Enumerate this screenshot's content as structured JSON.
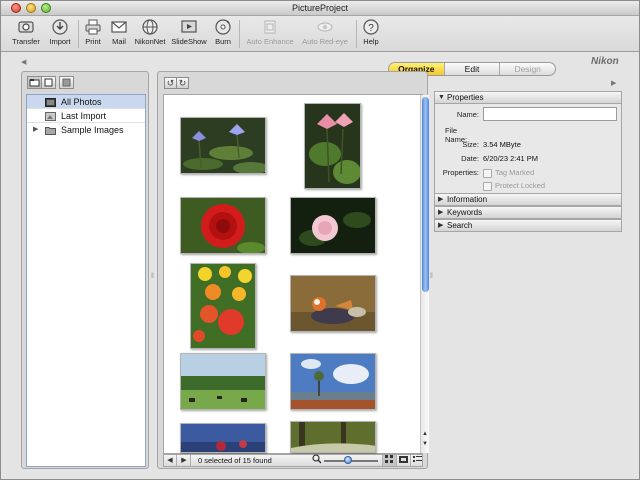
{
  "window": {
    "title": "PictureProject"
  },
  "toolbar": {
    "items": [
      {
        "label": "Transfer",
        "icon": "transfer-icon",
        "enabled": true
      },
      {
        "label": "Import",
        "icon": "import-icon",
        "enabled": true
      },
      {
        "label": "Print",
        "icon": "printer-icon",
        "enabled": true
      },
      {
        "label": "Mail",
        "icon": "mail-icon",
        "enabled": true
      },
      {
        "label": "NikonNet",
        "icon": "globe-icon",
        "enabled": true
      },
      {
        "label": "SlideShow",
        "icon": "slideshow-icon",
        "enabled": true
      },
      {
        "label": "Burn",
        "icon": "burn-disc-icon",
        "enabled": true
      },
      {
        "label": "Auto Enhance",
        "icon": "auto-enhance-icon",
        "enabled": false
      },
      {
        "label": "Auto Red-eye",
        "icon": "red-eye-icon",
        "enabled": false
      },
      {
        "label": "Help",
        "icon": "help-icon",
        "enabled": true
      }
    ]
  },
  "mode_tabs": {
    "items": [
      "Organize",
      "Edit",
      "Design"
    ],
    "active": "Organize"
  },
  "brand": {
    "logo_text": "Nikon"
  },
  "collections": {
    "items": [
      {
        "label": "All Photos",
        "selected": true,
        "icon": "photos-icon"
      },
      {
        "label": "Last Import",
        "selected": false,
        "icon": "import-folder-icon"
      },
      {
        "label": "Sample Images",
        "selected": false,
        "icon": "folder-icon",
        "collapsed": true
      }
    ]
  },
  "browser": {
    "status": "0 selected of 15 found",
    "zoom_level": 0.4,
    "view_mode": "thumbnails",
    "thumbnails": [
      "water-lilies-blue-photo",
      "pink-water-lily-photo",
      "red-rose-photo",
      "pink-rose-photo",
      "tulips-photo",
      "mandarin-duck-photo",
      "pasture-horses-photo",
      "tree-lake-photo",
      "flowers-blue-photo",
      "forest-stream-photo"
    ]
  },
  "inspector": {
    "properties_header": "Properties",
    "name_label": "Name:",
    "name_value": "",
    "file_name_label": "File Name:",
    "file_name_value": "",
    "size_label": "Size:",
    "size_value": "3.54 MByte",
    "date_label": "Date:",
    "date_value": "6/20/23 2:41 PM",
    "props_label": "Properties:",
    "tag_marked_label": "Tag Marked",
    "protect_locked_label": "Protect Locked",
    "information_header": "Information",
    "keywords_header": "Keywords",
    "search_header": "Search"
  },
  "colors": {
    "selection": "#c9d8ee",
    "active_tab": "#f2c92a",
    "scroll_thumb": "#4f86d9"
  }
}
